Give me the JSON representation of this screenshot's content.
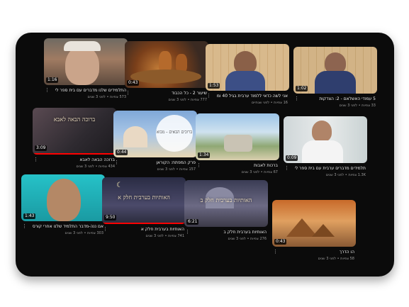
{
  "videos": [
    {
      "duration": "1:16",
      "title": "התלמידים שלנו מדברים עם בית ספר לי רעות",
      "meta": "573 צפיות • לפני 3 שנים"
    },
    {
      "duration": "0:43",
      "title": "שיעור 2 - כל הכבוד",
      "meta": "777 צפיות • לפני 3 שנים"
    },
    {
      "duration": "1:53",
      "title": "אני לשה כדאי ללמוד ערבית בגיל 40 ומתעכב ללמוד",
      "meta": "16 צפיות • לפני שנתיים"
    },
    {
      "duration": "1:02",
      "title": "5 עמודי האשלאם - 2: הצדקות",
      "meta": "33 צפיות • לפני 3 שנים"
    },
    {
      "duration": "3:09",
      "title": "ברוכה הבאה לאבא",
      "meta": "434 צפיות • לפני 3 שנים"
    },
    {
      "duration": "0:44",
      "title": "פרק המפתח: הקוראן",
      "meta": "157 צפיות • לפני 3 שנים"
    },
    {
      "duration": "1:34",
      "title": "ברכות לאבות",
      "meta": "67 צפיות • לפני 3 שנים"
    },
    {
      "duration": "0:09",
      "title": "תלמידים מדברים ערבית עם בית ספר לי רעות",
      "meta": "1.3K צפיות • לפני 3 שנים"
    },
    {
      "duration": "1:43",
      "title": "אם ננה-מדבר התלמיד שלנו אחרי קורס של 22 שעות עם בית ספר",
      "meta": "303 צפיות • לפני 3 שנים"
    },
    {
      "duration": "9:50",
      "title": "האותיות בערבית חלק א",
      "meta": "741 צפיות • לפני 3 שנים"
    },
    {
      "duration": "6:21",
      "title": "האותיות בערבית חלק ב",
      "meta": "276 צפיות • לפני 3 שנים"
    },
    {
      "duration": "0:43",
      "title": "הו הדרך",
      "meta": "58 צפיות • לפני 3 שנים"
    }
  ],
  "overlays": {
    "v5": "ברוכה הבאה לאבא",
    "v6": "ברוכים הבאים - מבוא",
    "v10": "האותיות בערבית חלק א",
    "v11": "האותיות בערבית חלק ב"
  },
  "colors": {
    "progress": "#ff0000",
    "background": "#0b0b0b"
  }
}
